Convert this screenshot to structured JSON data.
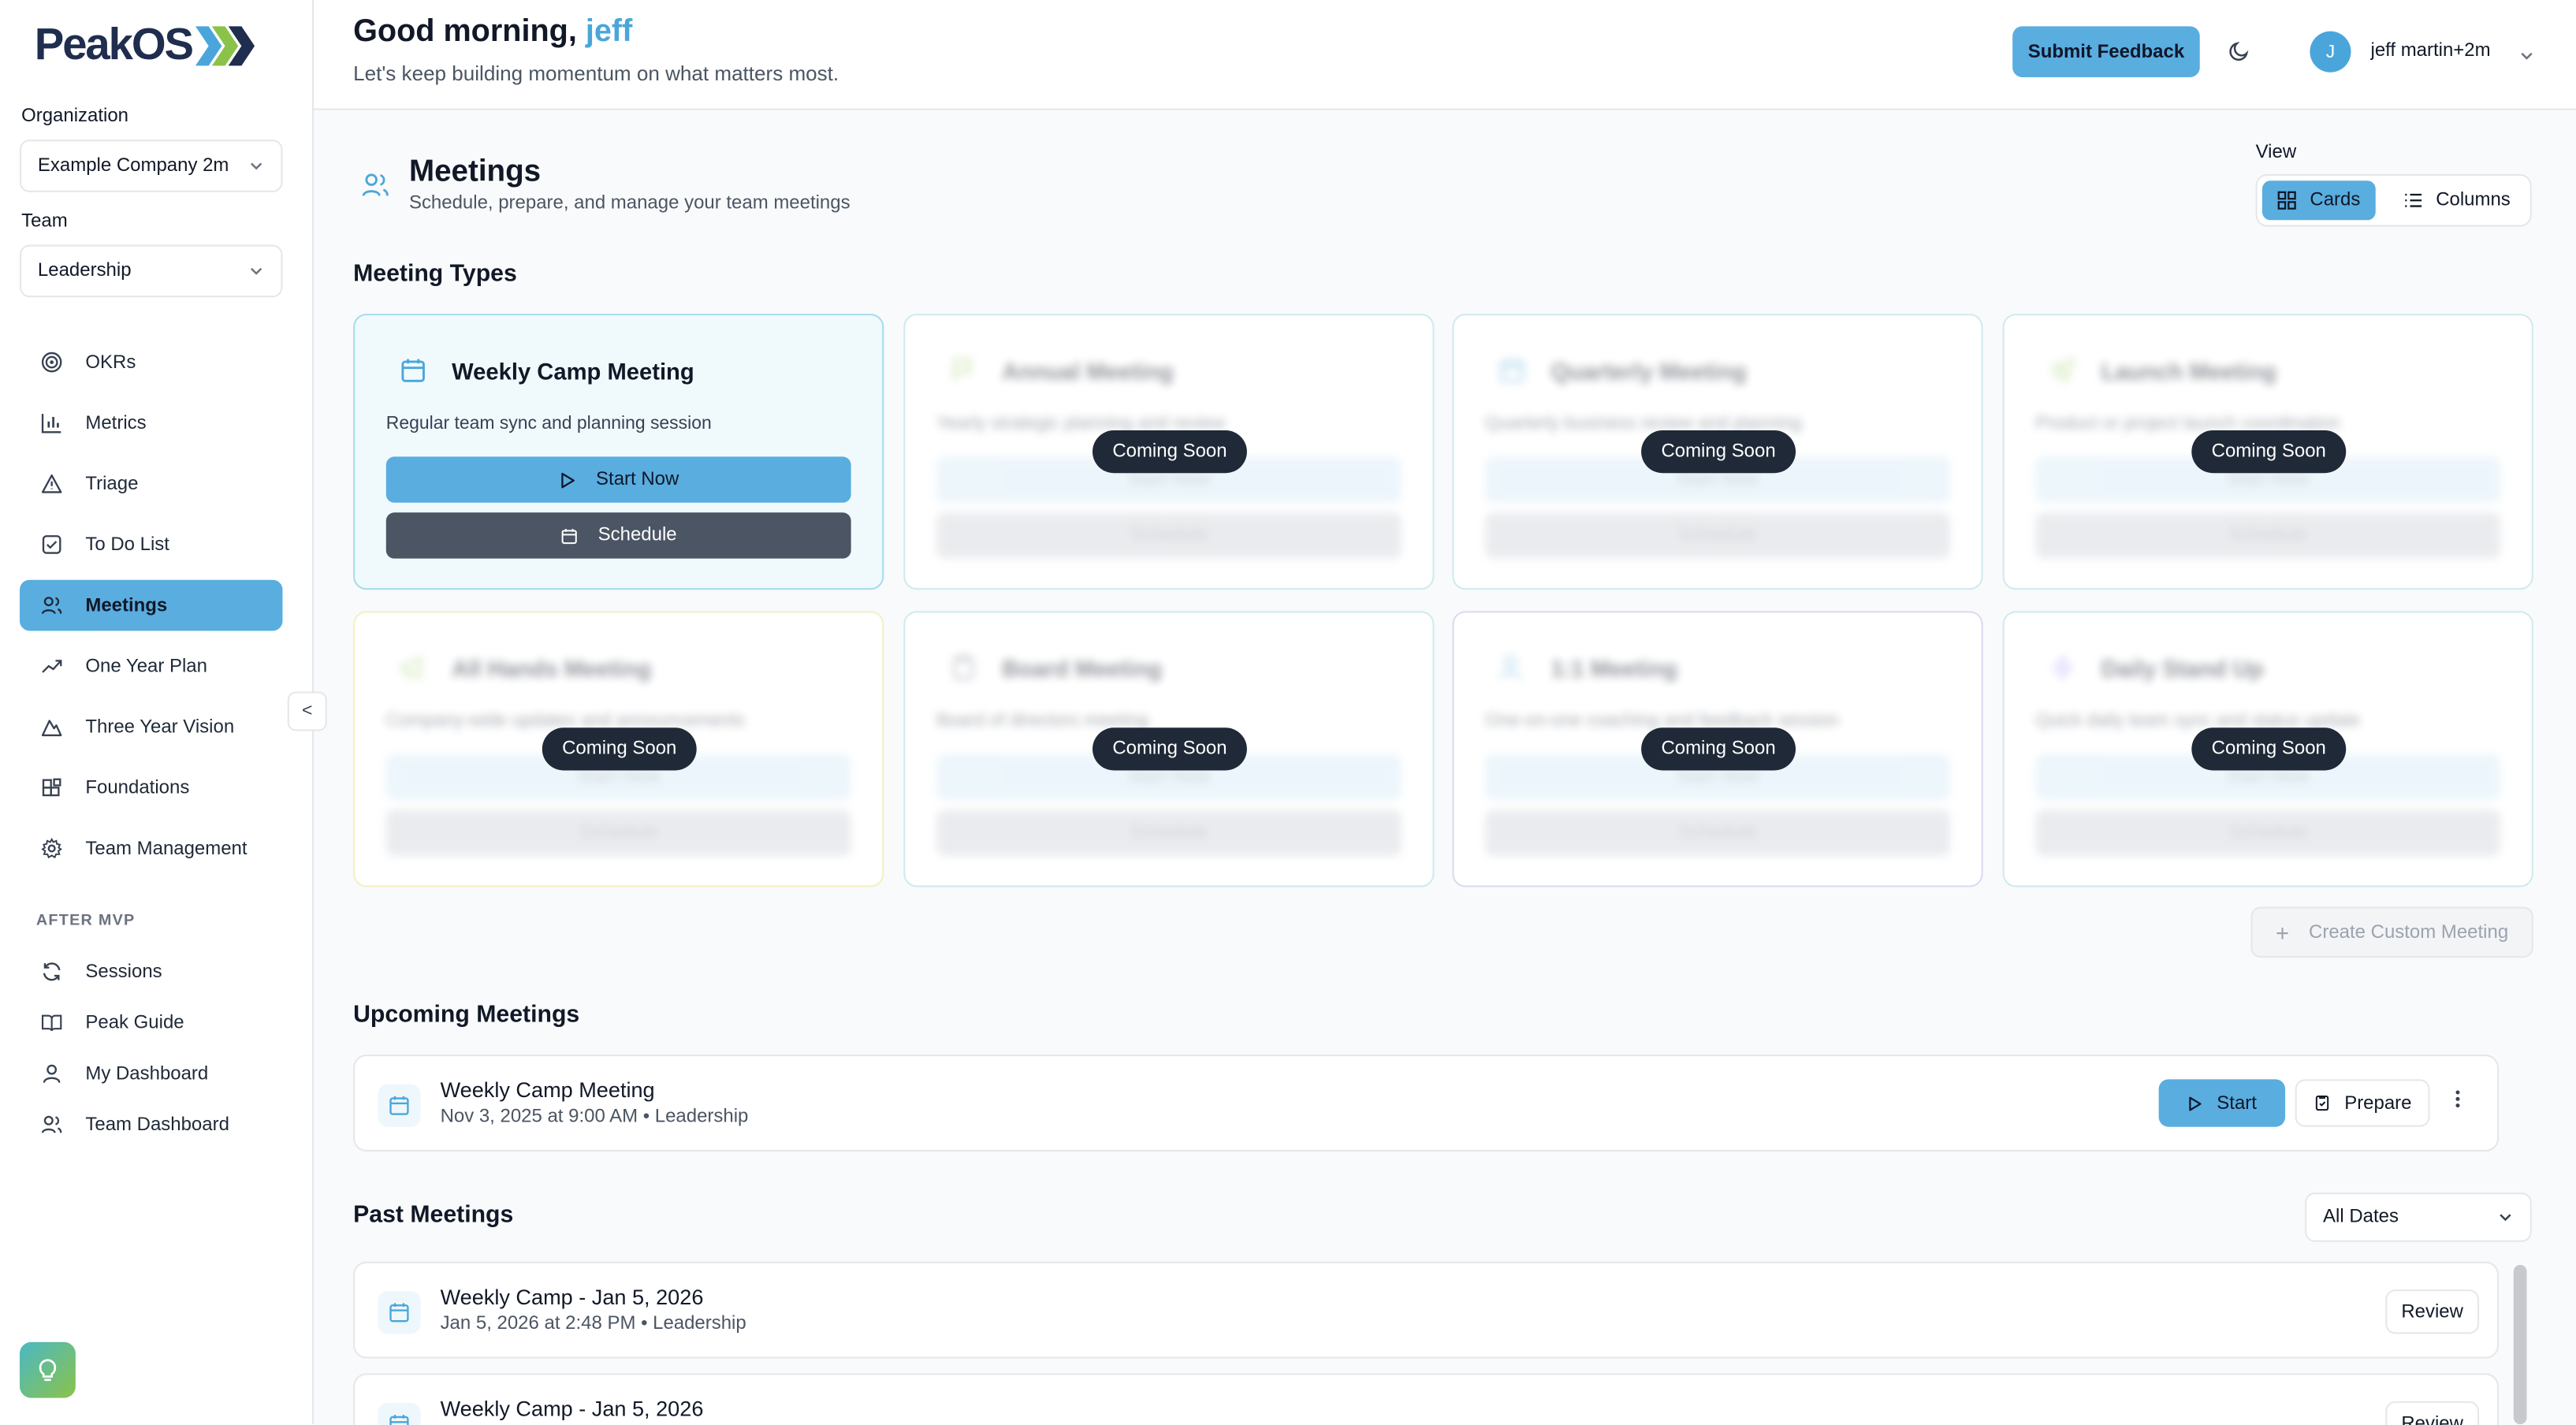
{
  "brand": {
    "name": "PeakOS"
  },
  "sidebar": {
    "org_label": "Organization",
    "org_value": "Example Company 2m",
    "team_label": "Team",
    "team_value": "Leadership",
    "nav": [
      {
        "label": "OKRs",
        "icon": "target-icon"
      },
      {
        "label": "Metrics",
        "icon": "bar-chart-icon"
      },
      {
        "label": "Triage",
        "icon": "warning-triangle-icon"
      },
      {
        "label": "To Do List",
        "icon": "checkbox-icon"
      },
      {
        "label": "Meetings",
        "icon": "users-icon",
        "active": true
      },
      {
        "label": "One Year Plan",
        "icon": "trending-up-icon"
      },
      {
        "label": "Three Year Vision",
        "icon": "mountain-icon"
      },
      {
        "label": "Foundations",
        "icon": "blocks-icon"
      },
      {
        "label": "Team Management",
        "icon": "gear-icon"
      }
    ],
    "section_label": "AFTER MVP",
    "nav2": [
      {
        "label": "Sessions",
        "icon": "refresh-icon"
      },
      {
        "label": "Peak Guide",
        "icon": "book-icon"
      },
      {
        "label": "My Dashboard",
        "icon": "user-icon"
      },
      {
        "label": "Team Dashboard",
        "icon": "users-icon"
      }
    ],
    "collapse_glyph": "<"
  },
  "header": {
    "greeting_prefix": "Good morning, ",
    "greeting_name": "jeff",
    "subtitle": "Let's keep building momentum on what matters most.",
    "feedback_label": "Submit Feedback",
    "avatar_initial": "J",
    "user_name": "jeff martin+2m"
  },
  "page": {
    "title": "Meetings",
    "subtitle": "Schedule, prepare, and manage your team meetings",
    "view_label": "View",
    "view_cards": "Cards",
    "view_columns": "Columns"
  },
  "meeting_types": {
    "heading": "Meeting Types",
    "start_label": "Start Now",
    "schedule_label": "Schedule",
    "coming_soon": "Coming Soon",
    "items": [
      {
        "title": "Weekly Camp Meeting",
        "desc": "Regular team sync and planning session",
        "icon": "calendar-icon",
        "available": true
      },
      {
        "title": "Annual Meeting",
        "desc": "Yearly strategic planning and review",
        "icon": "flag-icon"
      },
      {
        "title": "Quarterly Meeting",
        "desc": "Quarterly business review and planning",
        "icon": "calendar-icon"
      },
      {
        "title": "Launch Meeting",
        "desc": "Product or project launch coordination",
        "icon": "rocket-icon"
      },
      {
        "title": "All Hands Meeting",
        "desc": "Company-wide updates and announcements",
        "icon": "megaphone-icon"
      },
      {
        "title": "Board Meeting",
        "desc": "Board of directors meeting",
        "icon": "clipboard-icon"
      },
      {
        "title": "1:1 Meeting",
        "desc": "One-on-one coaching and feedback session",
        "icon": "user-icon"
      },
      {
        "title": "Daily Stand Up",
        "desc": "Quick daily team sync and status update",
        "icon": "zap-icon"
      }
    ],
    "create_label": "Create Custom Meeting"
  },
  "upcoming": {
    "heading": "Upcoming Meetings",
    "items": [
      {
        "title": "Weekly Camp Meeting",
        "sub": "Nov 3, 2025 at 9:00 AM • Leadership",
        "start_label": "Start",
        "prepare_label": "Prepare"
      }
    ]
  },
  "past": {
    "heading": "Past Meetings",
    "filter_value": "All Dates",
    "review_label": "Review",
    "items": [
      {
        "title": "Weekly Camp - Jan 5, 2026",
        "sub": "Jan 5, 2026 at 2:48 PM • Leadership"
      },
      {
        "title": "Weekly Camp - Jan 5, 2026",
        "sub": ""
      }
    ]
  },
  "colors": {
    "accent": "#5aaddf",
    "accent_text": "#4aa6da",
    "dark_button": "#4b5563",
    "badge": "#1f2937"
  }
}
